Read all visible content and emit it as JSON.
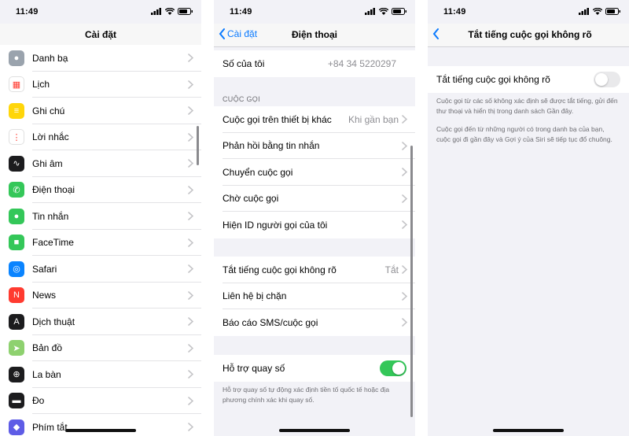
{
  "status": {
    "time": "11:49"
  },
  "settings": {
    "title": "Cài đặt",
    "items": [
      {
        "label": "Danh bạ",
        "icon": "contacts-icon",
        "color": "#9aa3ad"
      },
      {
        "label": "Lịch",
        "icon": "calendar-icon",
        "color": "#ffffff"
      },
      {
        "label": "Ghi chú",
        "icon": "notes-icon",
        "color": "#ffd60a"
      },
      {
        "label": "Lời nhắc",
        "icon": "reminders-icon",
        "color": "#ffffff"
      },
      {
        "label": "Ghi âm",
        "icon": "voice-memos-icon",
        "color": "#1c1c1e"
      },
      {
        "label": "Điện thoại",
        "icon": "phone-icon",
        "color": "#34c759"
      },
      {
        "label": "Tin nhắn",
        "icon": "messages-icon",
        "color": "#34c759"
      },
      {
        "label": "FaceTime",
        "icon": "facetime-icon",
        "color": "#34c759"
      },
      {
        "label": "Safari",
        "icon": "safari-icon",
        "color": "#0a84ff"
      },
      {
        "label": "News",
        "icon": "news-icon",
        "color": "#ff3b30"
      },
      {
        "label": "Dịch thuật",
        "icon": "translate-icon",
        "color": "#1c1c1e"
      },
      {
        "label": "Bản đồ",
        "icon": "maps-icon",
        "color": "#8ed16f"
      },
      {
        "label": "La bàn",
        "icon": "compass-icon",
        "color": "#1c1c1e"
      },
      {
        "label": "Đo",
        "icon": "measure-icon",
        "color": "#1c1c1e"
      },
      {
        "label": "Phím tắt",
        "icon": "shortcuts-icon",
        "color": "#5e5ce6"
      }
    ]
  },
  "phone": {
    "back": "Cài đặt",
    "title": "Điện thoại",
    "my_number_label": "Số của tôi",
    "my_number_value": "+84 34 5220297",
    "calls_header": "CUỘC GỌI",
    "calls": [
      {
        "label": "Cuộc gọi trên thiết bị khác",
        "value": "Khi gần bạn"
      },
      {
        "label": "Phản hồi bằng tin nhắn",
        "value": ""
      },
      {
        "label": "Chuyển cuộc gọi",
        "value": ""
      },
      {
        "label": "Chờ cuộc gọi",
        "value": ""
      },
      {
        "label": "Hiện ID người gọi của tôi",
        "value": ""
      }
    ],
    "block": [
      {
        "label": "Tắt tiếng cuộc gọi không rõ",
        "value": "Tắt"
      },
      {
        "label": "Liên hệ bị chặn",
        "value": ""
      },
      {
        "label": "Báo cáo SMS/cuộc gọi",
        "value": ""
      }
    ],
    "dial_assist_label": "Hỗ trợ quay số",
    "dial_assist_on": true,
    "dial_assist_footnote": "Hỗ trợ quay số tự động xác định tiền tố quốc tế hoặc địa phương chính xác khi quay số."
  },
  "silence": {
    "title": "Tắt tiếng cuộc gọi không rõ",
    "toggle_label": "Tắt tiếng cuộc gọi không rõ",
    "toggle_on": false,
    "note1": "Cuộc gọi từ các số không xác định sẽ được tắt tiếng, gửi đến thư thoại và hiển thị trong danh sách Gần đây.",
    "note2": "Cuộc gọi đến từ những người có trong danh bạ của bạn, cuộc gọi đi gần đây và Gợi ý của Siri sẽ tiếp tục đổ chuông."
  }
}
